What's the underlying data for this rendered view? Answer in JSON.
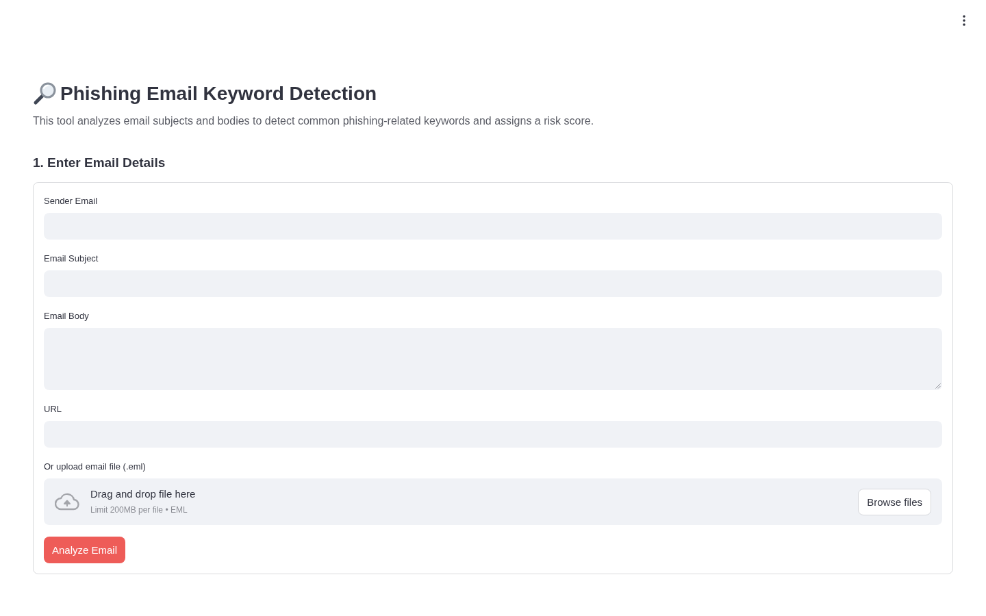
{
  "title": "Phishing Email Keyword Detection",
  "description": "This tool analyzes email subjects and bodies to detect common phishing-related keywords and assigns a risk score.",
  "section_heading": "1. Enter Email Details",
  "form": {
    "fields": [
      {
        "kind": "input",
        "label": "Sender Email"
      },
      {
        "kind": "input",
        "label": "Email Subject"
      },
      {
        "kind": "textarea",
        "label": "Email Body"
      },
      {
        "kind": "input",
        "label": "URL"
      },
      {
        "kind": "upload",
        "label": "Or upload email file (.eml)",
        "prompt": "Drag and drop file here",
        "limit": "Limit 200MB per file • EML",
        "button": "Browse files"
      }
    ],
    "submit_button": "Analyze Email"
  }
}
